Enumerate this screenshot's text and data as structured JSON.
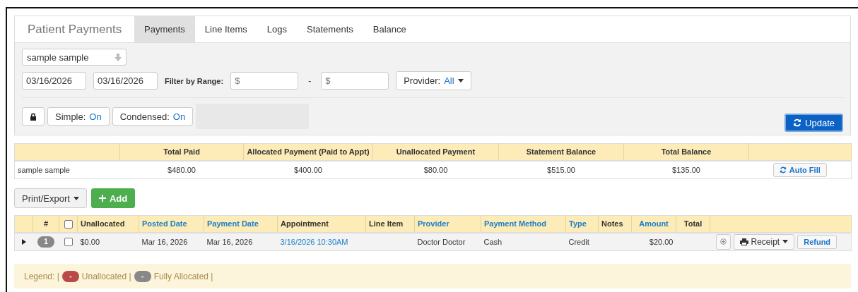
{
  "header": {
    "title": "Patient Payments",
    "tabs": [
      {
        "label": "Payments",
        "selected": true
      },
      {
        "label": "Line Items",
        "selected": false
      },
      {
        "label": "Logs",
        "selected": false
      },
      {
        "label": "Statements",
        "selected": false
      },
      {
        "label": "Balance",
        "selected": false
      }
    ]
  },
  "filters": {
    "patient": "sample sample",
    "date_from": "03/16/2026",
    "date_to": "03/16/2026",
    "range_label": "Filter by Range:",
    "range_min": {
      "placeholder": "$"
    },
    "range_sep": "-",
    "range_max": {
      "placeholder": "$"
    },
    "provider": {
      "label": "Provider:",
      "value": "All"
    },
    "toggles": [
      {
        "label": "Simple:",
        "value": "On"
      },
      {
        "label": "Condensed:",
        "value": "On"
      }
    ],
    "update": "Update"
  },
  "summary": {
    "columns": [
      "",
      "Total Paid",
      "Allocated Payment (Paid to Appt)",
      "Unallocated Payment",
      "Statement Balance",
      "Total Balance",
      ""
    ],
    "row": [
      "sample sample",
      "$480.00",
      "$400.00",
      "$80.00",
      "$515.00",
      "$135.00"
    ],
    "auto_fill": "Auto Fill"
  },
  "toolbar": {
    "export": "Print/Export",
    "add": "Add"
  },
  "payments": {
    "select_all_checked": false,
    "columns": [
      null,
      {
        "label": "#",
        "sortable": false
      },
      null,
      {
        "label": "Unallocated",
        "sortable": false
      },
      {
        "label": "Posted Date",
        "sortable": true
      },
      {
        "label": "Payment Date",
        "sortable": true
      },
      {
        "label": "Appointment",
        "sortable": false
      },
      {
        "label": "Line Item",
        "sortable": false
      },
      {
        "label": "Provider",
        "sortable": true
      },
      {
        "label": "Payment Method",
        "sortable": true
      },
      {
        "label": "Type",
        "sortable": true
      },
      {
        "label": "Notes",
        "sortable": false
      },
      {
        "label": "Amount",
        "sortable": true
      },
      {
        "label": "Total",
        "sortable": false
      },
      null
    ],
    "rows": [
      {
        "expanded": false,
        "number": "1",
        "color": "#888888",
        "checked": false,
        "unallocated": "$0.00",
        "posted_date": "Mar 16, 2026",
        "payment_date": "Mar 16, 2026",
        "appointment": "3/16/2026 10:30AM",
        "line_item": "",
        "provider": "Doctor Doctor",
        "payment_method": "Cash",
        "type": "Credit",
        "notes": "",
        "amount": "$20.00",
        "total": "",
        "receipt": "Receipt",
        "refund": "Refund"
      }
    ]
  },
  "legend": {
    "label": "Legend: |",
    "items": [
      {
        "badge": "-",
        "label": "Unallocated |",
        "color": "#b94a48"
      },
      {
        "badge": "-",
        "label": "Fully Allocated |",
        "color": "#888888"
      }
    ]
  }
}
